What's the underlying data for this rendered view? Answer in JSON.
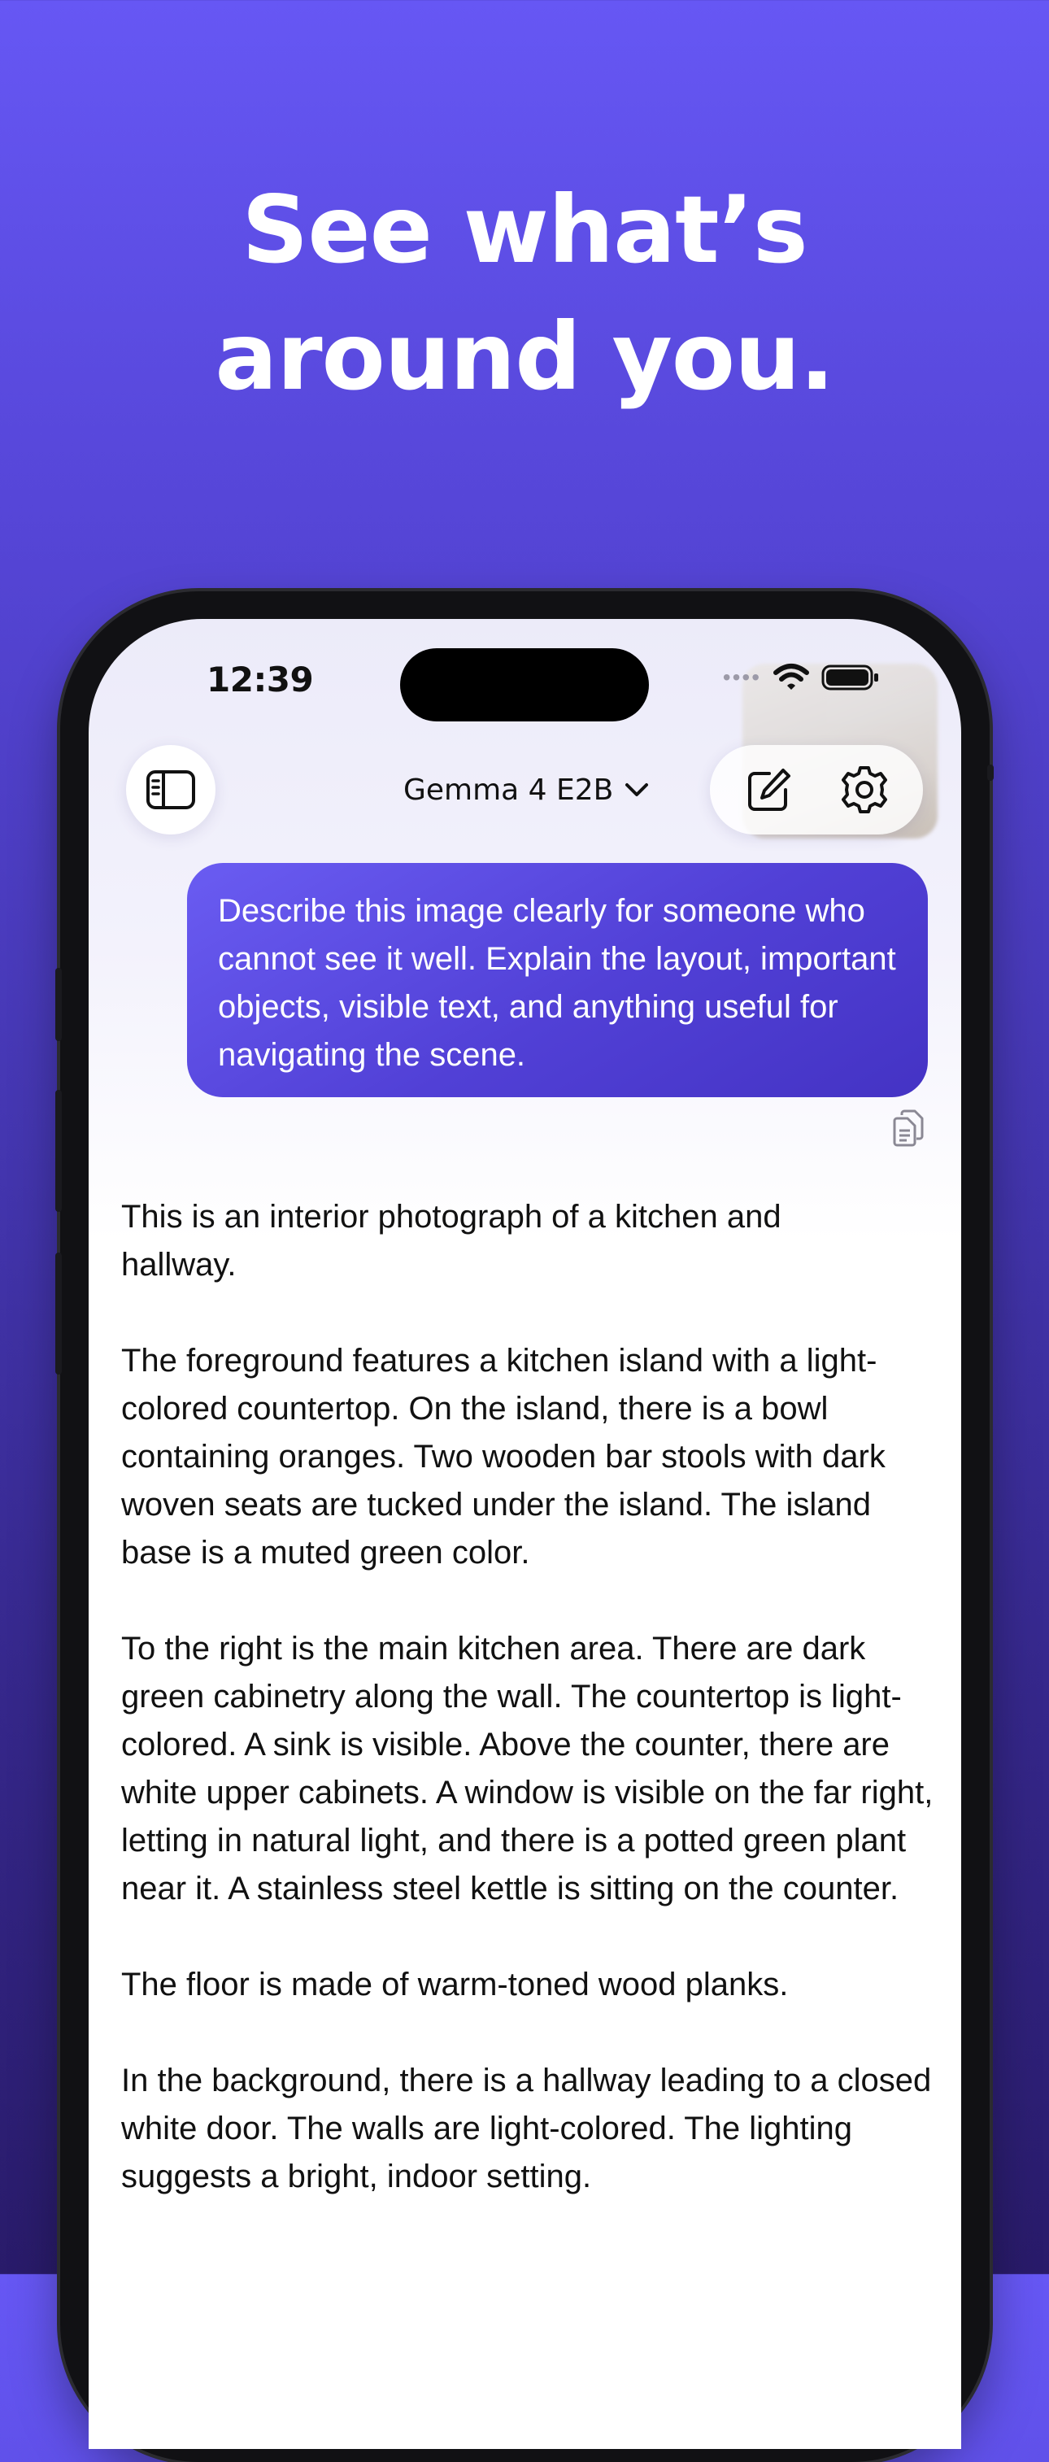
{
  "headline": {
    "line1": "See what’s",
    "line2": "around you."
  },
  "status_bar": {
    "time": "12:39",
    "dots": "••••"
  },
  "toolbar": {
    "model_name": "Gemma 4 E2B"
  },
  "chat": {
    "user_message": "Describe this image clearly for someone who cannot see it well. Explain the layout, important objects, visible text, and anything useful for navigating the scene.",
    "response_paragraphs": [
      "This is an interior photograph of a kitchen and hallway.",
      "The foreground features a kitchen island with a light-colored countertop. On the island, there is a bowl containing oranges. Two wooden bar stools with dark woven seats are tucked under the island. The island base is a muted green color.",
      "To the right is the main kitchen area. There are dark green cabinetry along the wall. The countertop is light-colored. A sink is visible. Above the counter, there are white upper cabinets. A window is visible on the far right, letting in natural light, and there is a potted green plant near it. A stainless steel kettle is sitting on the counter.",
      "The floor is made of warm-toned wood planks.",
      "In the background, there is a hallway leading to a closed white door. The walls are light-colored. The lighting suggests a bright, indoor setting."
    ]
  },
  "colors": {
    "background_top": "#6657f4",
    "background_bottom": "#291b6a",
    "bubble": "#5140d6"
  },
  "icons": [
    "sidebar-icon",
    "chevron-down-icon",
    "new-chat-icon",
    "gear-icon",
    "copy-icon",
    "wifi-icon",
    "battery-icon"
  ]
}
